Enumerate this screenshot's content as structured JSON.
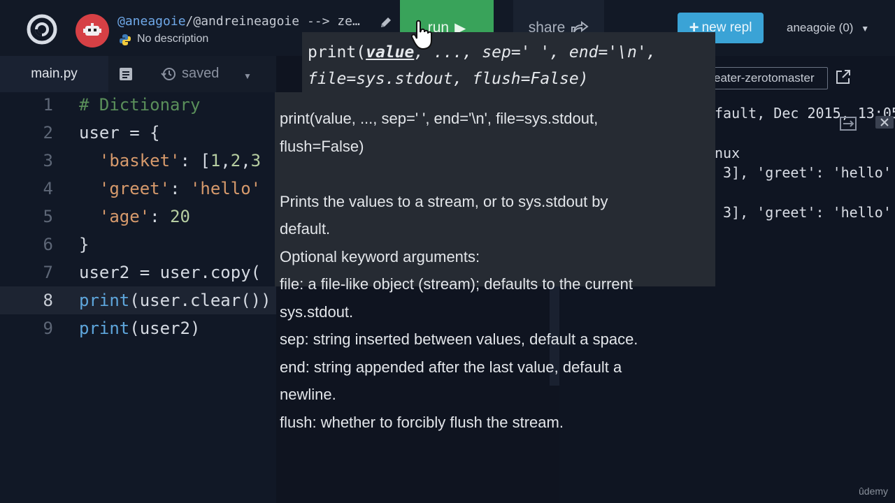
{
  "header": {
    "user_link": "@aneagoie",
    "repl_rest": "/@andreineagoie --> ze…",
    "description": "No description",
    "run_label": "run",
    "share_label": "share",
    "new_repl_label": "new repl",
    "account_label": "aneagoie (0)",
    "run_color": "#39a35a",
    "new_repl_color": "#3aa3d6"
  },
  "editor": {
    "tab_label": "main.py",
    "saved_label": "saved",
    "lines": [
      {
        "n": "1",
        "parts": [
          {
            "t": "# Dictionary",
            "c": "c-comment"
          }
        ]
      },
      {
        "n": "2",
        "parts": [
          {
            "t": "user = {",
            "c": ""
          }
        ]
      },
      {
        "n": "3",
        "parts": [
          {
            "t": "  ",
            "c": ""
          },
          {
            "t": "'basket'",
            "c": "c-str"
          },
          {
            "t": ": [",
            "c": ""
          },
          {
            "t": "1",
            "c": "c-num"
          },
          {
            "t": ",",
            "c": ""
          },
          {
            "t": "2",
            "c": "c-num"
          },
          {
            "t": ",",
            "c": ""
          },
          {
            "t": "3",
            "c": "c-num"
          }
        ]
      },
      {
        "n": "4",
        "parts": [
          {
            "t": "  ",
            "c": ""
          },
          {
            "t": "'greet'",
            "c": "c-str"
          },
          {
            "t": ": ",
            "c": ""
          },
          {
            "t": "'hello'",
            "c": "c-str"
          }
        ]
      },
      {
        "n": "5",
        "parts": [
          {
            "t": "  ",
            "c": ""
          },
          {
            "t": "'age'",
            "c": "c-str"
          },
          {
            "t": ": ",
            "c": ""
          },
          {
            "t": "20",
            "c": "c-num"
          }
        ]
      },
      {
        "n": "6",
        "parts": [
          {
            "t": "}",
            "c": ""
          }
        ]
      },
      {
        "n": "7",
        "parts": [
          {
            "t": "user2 = user.copy(",
            "c": ""
          }
        ]
      },
      {
        "n": "8",
        "parts": [
          {
            "t": "print",
            "c": "c-kw"
          },
          {
            "t": "(user.clear())",
            "c": ""
          }
        ]
      },
      {
        "n": "9",
        "parts": [
          {
            "t": "print",
            "c": "c-kw"
          },
          {
            "t": "(user2)",
            "c": ""
          }
        ]
      }
    ]
  },
  "hint": {
    "signature_line1_pre": "print(",
    "signature_param": "value",
    "signature_line1_post": ", ..., sep=' ', end='\\n',",
    "signature_line2": "file=sys.stdout, flush=False)",
    "doc_lines": [
      "print(value, ..., sep=' ', end='\\n', file=sys.stdout,",
      "flush=False)",
      "",
      "Prints the values to a stream, or to sys.stdout by",
      "default.",
      "Optional keyword arguments:",
      "file:  a file-like object (stream); defaults to the current",
      "sys.stdout.",
      "sep:   string inserted between values, default a space.",
      "end:   string appended after the last value, default a",
      "newline.",
      "flush: whether to forcibly flush the stream."
    ]
  },
  "console": {
    "url_text": "eater-zerotomaster",
    "lines": [
      "fault, Dec 2015, 13:05",
      "",
      "nux",
      " 3], 'greet': 'hello'",
      "",
      " 3], 'greet': 'hello'"
    ]
  },
  "watermark": "ûdemy"
}
